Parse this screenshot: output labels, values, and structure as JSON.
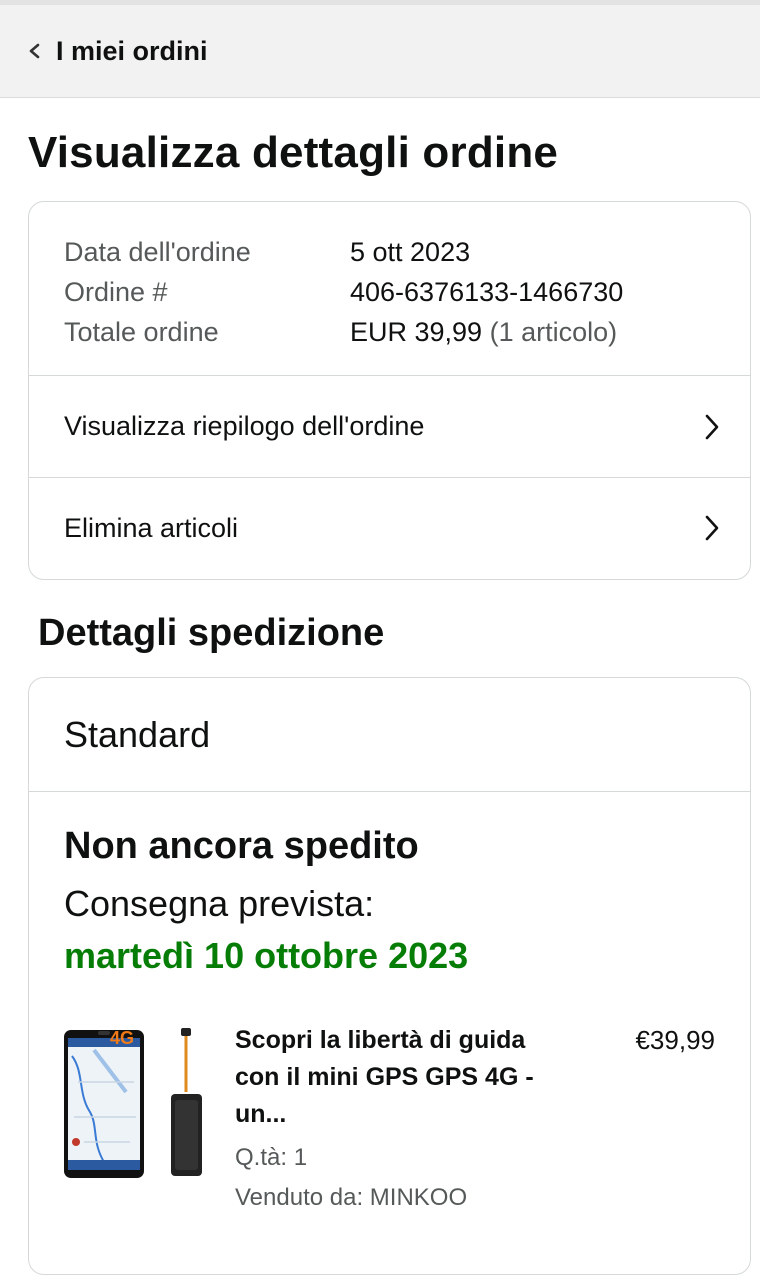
{
  "header": {
    "back_label": "I miei ordini"
  },
  "page_title": "Visualizza dettagli ordine",
  "order_info": {
    "date_label": "Data dell'ordine",
    "date_value": "5 ott 2023",
    "number_label": "Ordine #",
    "number_value": "406-6376133-1466730",
    "total_label": "Totale ordine",
    "total_value": "EUR 39,99",
    "total_items": "(1 articolo)"
  },
  "links": {
    "summary": "Visualizza riepilogo dell'ordine",
    "remove": "Elimina articoli"
  },
  "shipping": {
    "section_title": "Dettagli spedizione",
    "method": "Standard",
    "status": "Non ancora spedito",
    "delivery_label": "Consegna prevista:",
    "delivery_date": "martedì 10 ottobre 2023",
    "delivery_color": "#067d06"
  },
  "product": {
    "title": "Scopri la libertà di guida con il mini GPS GPS 4G - un...",
    "price": "€39,99",
    "quantity": "Q.tà: 1",
    "seller": "Venduto da: MINKOO",
    "badge": "4G"
  }
}
